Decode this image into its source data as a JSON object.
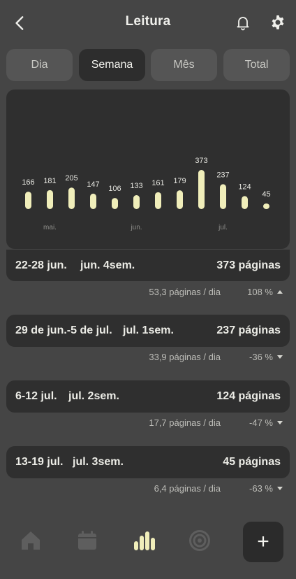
{
  "header": {
    "title": "Leitura",
    "back_icon": "chevron-left-icon",
    "notification_icon": "bell-icon",
    "settings_icon": "gear-icon"
  },
  "tabs": [
    {
      "label": "Dia",
      "active": false
    },
    {
      "label": "Semana",
      "active": true
    },
    {
      "label": "Mês",
      "active": false
    },
    {
      "label": "Total",
      "active": false
    }
  ],
  "chart_data": {
    "type": "bar",
    "values": [
      166,
      181,
      205,
      147,
      106,
      133,
      161,
      179,
      373,
      237,
      124,
      45
    ],
    "value_labels": [
      "166",
      "181",
      "205",
      "147",
      "106",
      "133",
      "161",
      "179",
      "373",
      "237",
      "124",
      "45"
    ],
    "month_labels": [
      {
        "label": "mai.",
        "bar_index": 1
      },
      {
        "label": "jun.",
        "bar_index": 5
      },
      {
        "label": "jul.",
        "bar_index": 9
      }
    ],
    "highlighted_index": 8,
    "bar_color": "#f0eeba",
    "title": "",
    "xlabel": "",
    "ylabel": ""
  },
  "weeks": [
    {
      "range": "22-28 jun.",
      "label": "jun. 4sem.",
      "pages": "373 páginas",
      "avg": "53,3 páginas / dia",
      "change": "108 %",
      "direction": "up"
    },
    {
      "range": "29 de jun.-5 de jul.",
      "label": "jul. 1sem.",
      "pages": "237 páginas",
      "avg": "33,9 páginas / dia",
      "change": "-36 %",
      "direction": "down"
    },
    {
      "range": "6-12 jul.",
      "label": "jul. 2sem.",
      "pages": "124 páginas",
      "avg": "17,7 páginas / dia",
      "change": "-47 %",
      "direction": "down"
    },
    {
      "range": "13-19 jul.",
      "label": "jul. 3sem.",
      "pages": "45 páginas",
      "avg": "6,4 páginas / dia",
      "change": "-63 %",
      "direction": "down"
    }
  ],
  "bottom_nav": {
    "items": [
      "home-icon",
      "calendar-icon",
      "bar-chart-icon",
      "target-icon"
    ],
    "active_index": 2,
    "add_label": "+"
  },
  "colors": {
    "background": "#454545",
    "card": "#2f2f2f",
    "accent": "#f0eeba"
  }
}
